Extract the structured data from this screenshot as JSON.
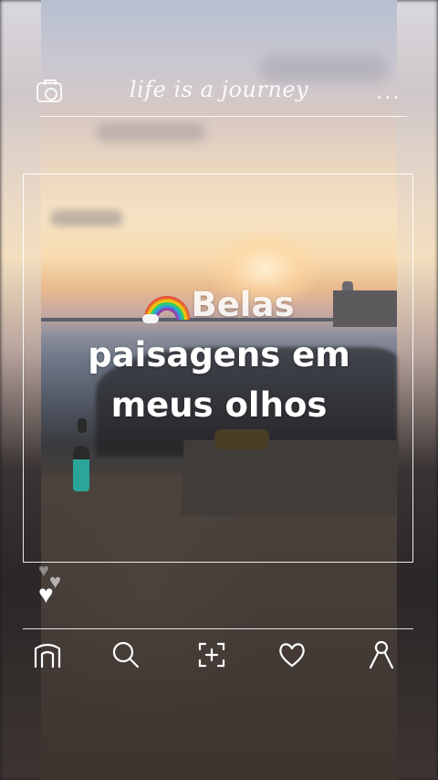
{
  "header": {
    "title": "life is a journey",
    "camera_icon": "camera-icon",
    "more_icon": "more-icon",
    "more_label": "..."
  },
  "post": {
    "caption_line1": "Belas",
    "caption_line2": "paisagens em",
    "caption_line3": "meus olhos",
    "emoji_icon": "rainbow-icon"
  },
  "reactions": {
    "heart_glyph": "♥"
  },
  "nav": {
    "items": [
      {
        "name": "home-icon"
      },
      {
        "name": "search-icon"
      },
      {
        "name": "add-post-icon"
      },
      {
        "name": "heart-icon"
      },
      {
        "name": "profile-icon"
      }
    ]
  },
  "colors": {
    "icons": "#ffffff",
    "caption": "#ffffff"
  }
}
